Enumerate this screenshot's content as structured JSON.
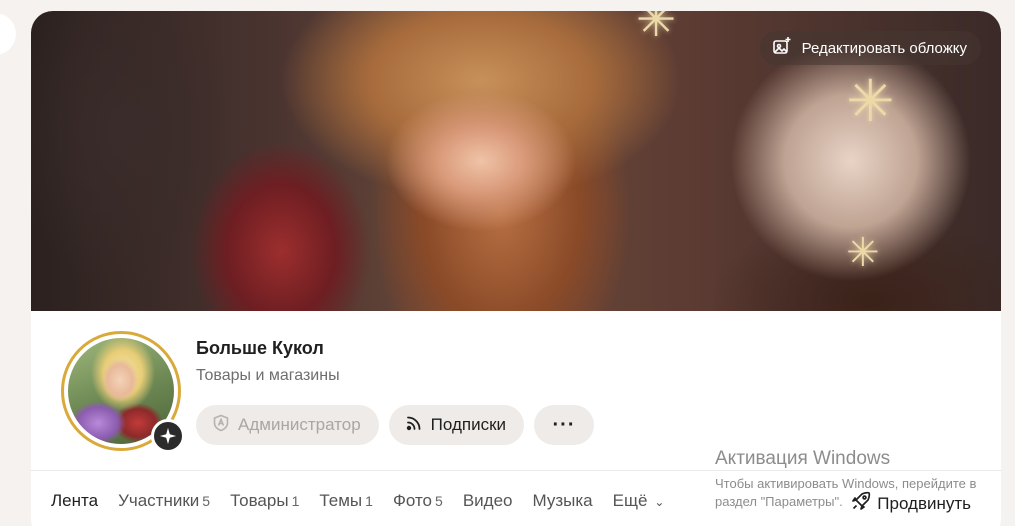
{
  "cover": {
    "edit_label": "Редактировать обложку"
  },
  "group": {
    "title": "Больше Кукол",
    "category": "Товары и магазины"
  },
  "actions": {
    "admin_label": "Администратор",
    "subscriptions_label": "Подписки",
    "more_label": "···"
  },
  "tabs": [
    {
      "label": "Лента",
      "count": ""
    },
    {
      "label": "Участники",
      "count": "5"
    },
    {
      "label": "Товары",
      "count": "1"
    },
    {
      "label": "Темы",
      "count": "1"
    },
    {
      "label": "Фото",
      "count": "5"
    },
    {
      "label": "Видео",
      "count": ""
    },
    {
      "label": "Музыка",
      "count": ""
    },
    {
      "label": "Ещё",
      "count": ""
    }
  ],
  "promote_label": "Продвинуть",
  "watermark": {
    "title": "Активация Windows",
    "line1": "Чтобы активировать Windows, перейдите в",
    "line2": "раздел \"Параметры\"."
  }
}
